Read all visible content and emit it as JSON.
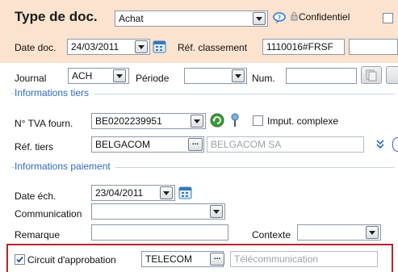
{
  "header": {
    "title": "Type de doc.",
    "doc_type_value": "Achat",
    "confidential_label": "Confidentiel",
    "date_label": "Date doc.",
    "date_value": "24/03/2011",
    "ref_label": "Réf. classement",
    "ref_value": "1110016#FRSF"
  },
  "journal": {
    "journal_label": "Journal",
    "journal_value": "ACH",
    "periode_label": "Période",
    "periode_value": "",
    "num_label": "Num.",
    "num_value": ""
  },
  "tiers": {
    "section_title": "Informations tiers",
    "tva_label": "N° TVA fourn.",
    "tva_value": "BE0202239951",
    "imput_label": "Imput. complexe",
    "ref_label": "Réf. tiers",
    "ref_value": "BELGACOM",
    "ref_name": "BELGACOM SA"
  },
  "paiement": {
    "section_title": "Informations paiement",
    "date_label": "Date éch.",
    "date_value": "23/04/2011",
    "communication_label": "Communication",
    "communication_value": "",
    "remarque_label": "Remarque",
    "remarque_value": "",
    "contexte_label": "Contexte",
    "contexte_value": ""
  },
  "approbation": {
    "checkbox_label": "Circuit d'approbation",
    "checked": true,
    "code_value": "TELECOM",
    "description_placeholder": "Télécommunication"
  },
  "colors": {
    "header_band": "#fbe3cf",
    "section_title": "#2e6cc0",
    "highlight_border": "#b3262a"
  }
}
